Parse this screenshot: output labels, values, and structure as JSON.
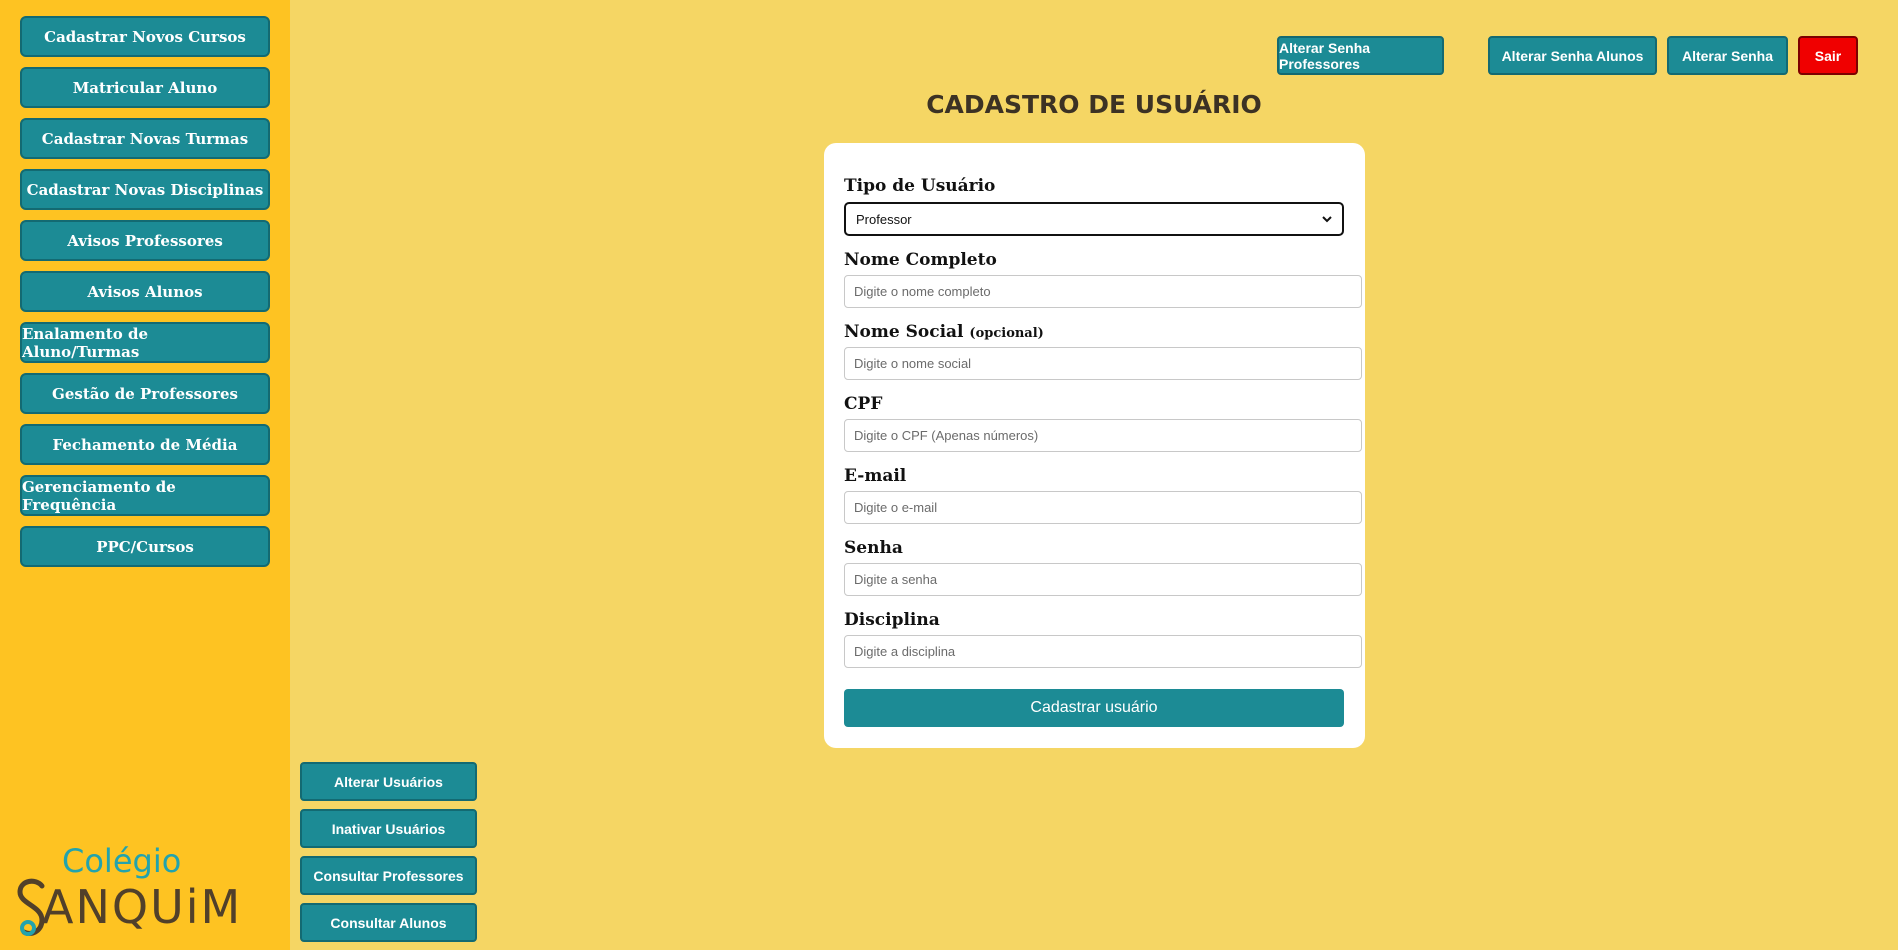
{
  "sidebar": {
    "items": [
      {
        "label": "Cadastrar Novos Cursos"
      },
      {
        "label": "Matricular Aluno"
      },
      {
        "label": "Cadastrar Novas Turmas"
      },
      {
        "label": "Cadastrar Novas Disciplinas"
      },
      {
        "label": "Avisos Professores"
      },
      {
        "label": "Avisos Alunos"
      },
      {
        "label": "Enalamento de Aluno/Turmas"
      },
      {
        "label": "Gestão de Professores"
      },
      {
        "label": "Fechamento de Média"
      },
      {
        "label": "Gerenciamento de Frequência"
      },
      {
        "label": "PPC/Cursos"
      }
    ],
    "logo": {
      "top": "Colégio",
      "bottom": "ANQUiM"
    }
  },
  "header": {
    "buttons": [
      {
        "label": "Alterar Senha Professores"
      },
      {
        "label": "Alterar Senha Alunos"
      },
      {
        "label": "Alterar Senha"
      },
      {
        "label": "Sair"
      }
    ]
  },
  "main": {
    "title": "CADASTRO DE USUÁRIO",
    "form": {
      "user_type": {
        "label": "Tipo de Usuário",
        "value": "Professor"
      },
      "full_name": {
        "label": "Nome Completo",
        "placeholder": "Digite o nome completo"
      },
      "social_name": {
        "label": "Nome Social",
        "optional": "(opcional)",
        "placeholder": "Digite o nome social"
      },
      "cpf": {
        "label": "CPF",
        "placeholder": "Digite o CPF (Apenas números)"
      },
      "email": {
        "label": "E-mail",
        "placeholder": "Digite o e-mail"
      },
      "password": {
        "label": "Senha",
        "placeholder": "Digite a senha"
      },
      "discipline": {
        "label": "Disciplina",
        "placeholder": "Digite a disciplina"
      },
      "submit": "Cadastrar usuário"
    }
  },
  "bottom": {
    "buttons": [
      {
        "label": "Alterar Usuários"
      },
      {
        "label": "Inativar Usuários"
      },
      {
        "label": "Consultar Professores"
      },
      {
        "label": "Consultar Alunos"
      }
    ]
  },
  "colors": {
    "background": "#f5d664",
    "sidebar": "#fec322",
    "button": "#1c8b95",
    "exit": "#f00000"
  }
}
